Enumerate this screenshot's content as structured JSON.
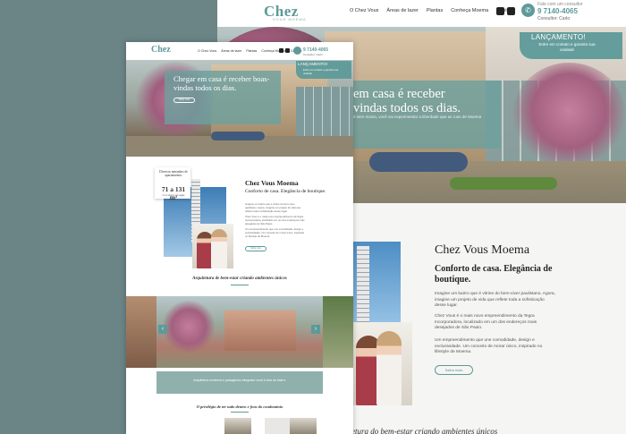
{
  "brand": {
    "logo": "Chez",
    "logo_sub": "VOUS MOEMA"
  },
  "nav": {
    "items": [
      "O Chez Vous",
      "Áreas de lazer",
      "Plantas",
      "Conheça Moema",
      "Contato"
    ]
  },
  "contact": {
    "label": "Fale com um consultor",
    "phone": "9 7140-4065",
    "consultant": "Consultor: Carlo"
  },
  "hero": {
    "title": "Chegar em casa é receber boas-vindas todos os dias.",
    "back_title": "em casa é receber\nvindas todos os dias.",
    "subtitle": "é sem mania, você vai experimentar a liberdade que as ruas de Moema",
    "button": "Saiba mais"
  },
  "launch": {
    "title": "LANÇAMENTO!",
    "subtitle": "Entre em contato e garanta sua unidade"
  },
  "intro": {
    "card_top": "Diversos tamanhos de apartamentos",
    "card_value": "71 a 131 m²",
    "card_note": "3 e 4 dorms | 2 vagas",
    "heading": "Chez Vous Moema",
    "subheading": "Conforto de casa. Elegância de boutique.",
    "p1": "Imagine um bairro que é vitrine do bem-viver paulistano. Agora, imagine um projeto de vida que reflete toda a sofisticação desse lugar.",
    "p2": "Chez Vous é o mais novo empreendimento da Tegra Incorporadora, localizado em um dos endereços mais desejados de São Paulo.",
    "p3": "Um empreendimento que une comodidade, design e exclusividade. Um conceito de morar único, inspirado no lifestyle de Moema.",
    "button": "Saiba mais"
  },
  "sections": {
    "architecture": "Arquitetura de bem-estar criando ambientes únicos",
    "architecture_back": "etura do bem-estar criando ambientes únicos",
    "privilege": "O privilégio de ter tudo dentro e fora do condomínio"
  },
  "gallery": {
    "caption": "Arquitetura moderna e paisagismo integrado você à vida do bairro.",
    "prev": "‹",
    "next": "›"
  },
  "colors": {
    "accent": "#5d9a99",
    "backdrop": "#6b8486"
  }
}
